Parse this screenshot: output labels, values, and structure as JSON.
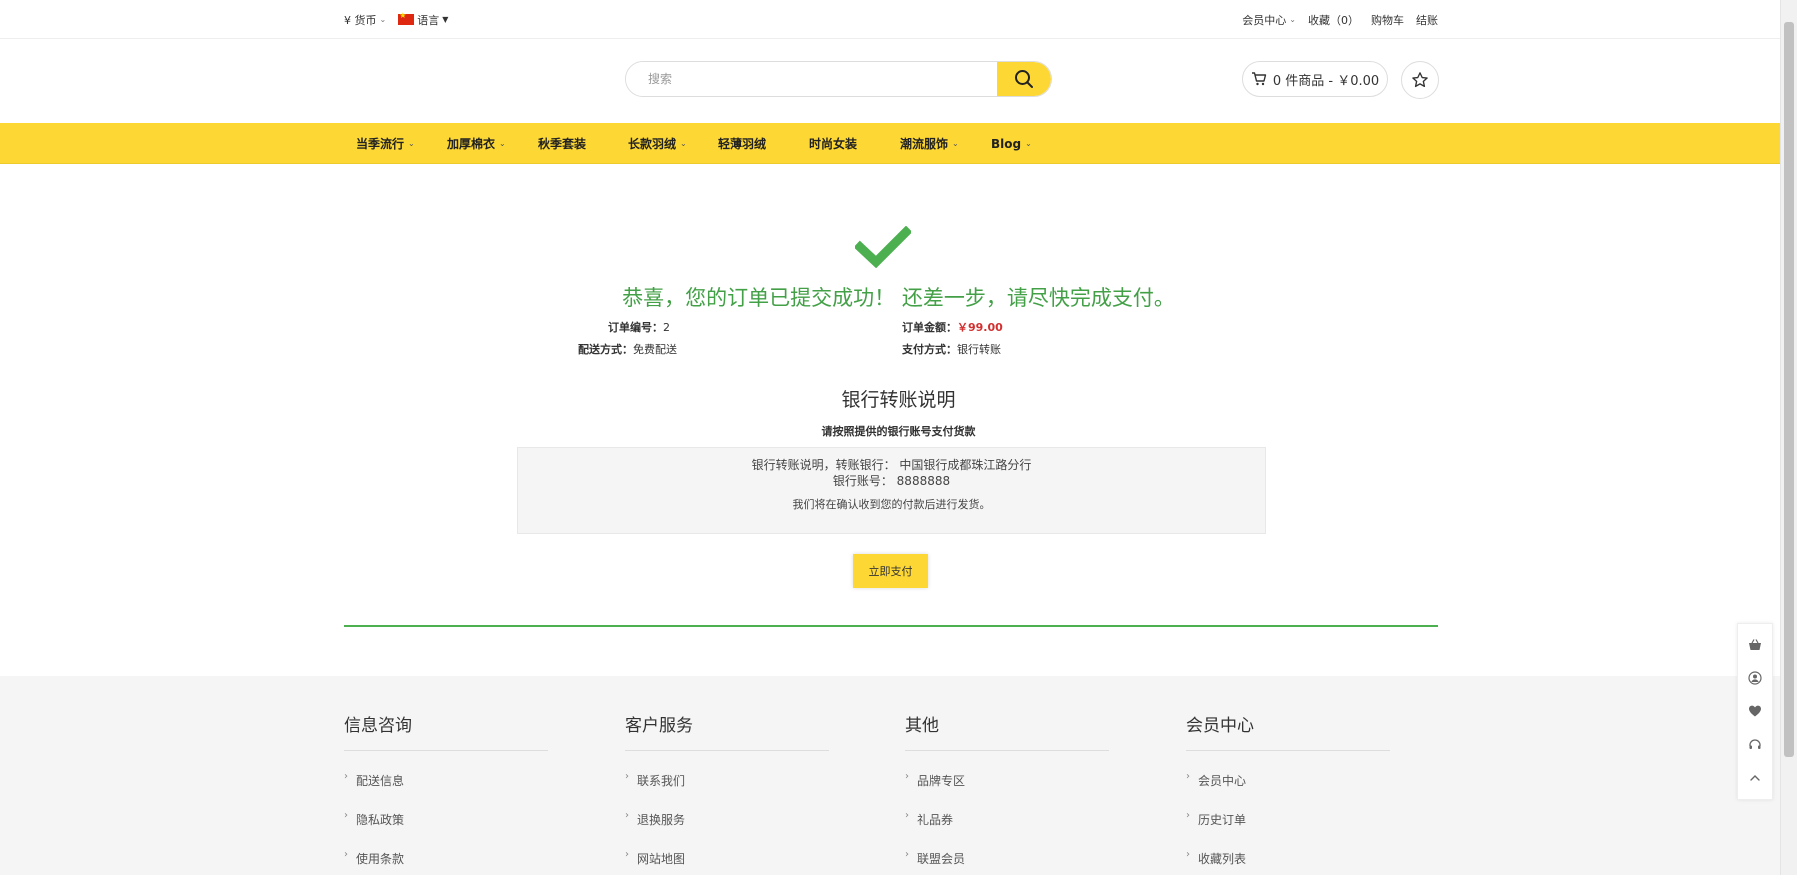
{
  "topbar": {
    "currency": "¥ 货币",
    "language": "语言",
    "member_center": "会员中心",
    "favorites": "收藏（0）",
    "cart": "购物车",
    "checkout": "结账"
  },
  "search": {
    "placeholder": "搜索"
  },
  "cart_summary": "0 件商品 - ￥0.00",
  "nav": {
    "items": [
      {
        "label": "当季流行",
        "has_dropdown": true
      },
      {
        "label": "加厚棉衣",
        "has_dropdown": true
      },
      {
        "label": "秋季套装",
        "has_dropdown": false
      },
      {
        "label": "长款羽绒",
        "has_dropdown": true
      },
      {
        "label": "轻薄羽绒",
        "has_dropdown": false
      },
      {
        "label": "时尚女装",
        "has_dropdown": false
      },
      {
        "label": "潮流服饰",
        "has_dropdown": true
      },
      {
        "label": "Blog",
        "has_dropdown": true
      }
    ]
  },
  "order": {
    "success_message": "恭喜，您的订单已提交成功！ 还差一步，请尽快完成支付。",
    "number_label": "订单编号：",
    "number": "2",
    "amount_label": "订单金额：",
    "amount": "￥99.00",
    "shipping_label": "配送方式：",
    "shipping": "免费配送",
    "payment_label": "支付方式：",
    "payment": "银行转账"
  },
  "bank": {
    "title": "银行转账说明",
    "subtitle": "请按照提供的银行账号支付货款",
    "line1": "银行转账说明，转账银行：  中国银行成都珠江路分行",
    "line2": "银行账号：  8888888",
    "note": "我们将在确认收到您的付款后进行发货。",
    "pay_button": "立即支付"
  },
  "footer": {
    "columns": [
      {
        "title": "信息咨询",
        "links": [
          "配送信息",
          "隐私政策",
          "使用条款"
        ]
      },
      {
        "title": "客户服务",
        "links": [
          "联系我们",
          "退换服务",
          "网站地图"
        ]
      },
      {
        "title": "其他",
        "links": [
          "品牌专区",
          "礼品券",
          "联盟会员"
        ]
      },
      {
        "title": "会员中心",
        "links": [
          "会员中心",
          "历史订单",
          "收藏列表"
        ]
      }
    ]
  },
  "colors": {
    "accent_yellow": "#fdd835",
    "success_green": "#43a047",
    "price_red": "#d32f2f"
  }
}
